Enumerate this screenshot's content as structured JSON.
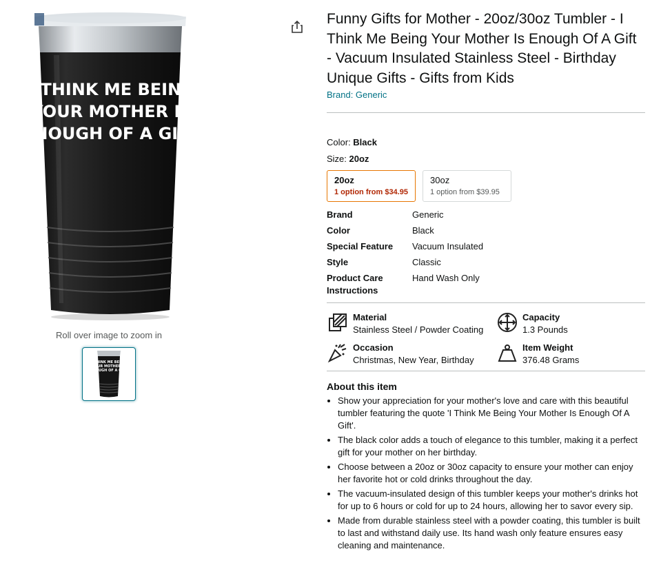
{
  "product": {
    "title": "Funny Gifts for Mother - 20oz/30oz Tumbler - I Think Me Being Your Mother Is Enough Of A Gift - Vacuum Insulated Stainless Steel - Birthday Unique Gifts - Gifts from Kids",
    "brand_link": "Brand: Generic",
    "image_text": [
      "I THINK ME BEING",
      "YOUR MOTHER IS",
      "ENOUGH OF A GIFT"
    ],
    "zoom_hint": "Roll over image to zoom in"
  },
  "variations": {
    "color_label": "Color: ",
    "color_value": "Black",
    "size_label": "Size: ",
    "size_value": "20oz",
    "options": [
      {
        "label": "20oz",
        "price": "1 option from $34.95",
        "selected": true
      },
      {
        "label": "30oz",
        "price": "1 option from $39.95",
        "selected": false
      }
    ]
  },
  "specs": [
    {
      "key": "Brand",
      "value": "Generic"
    },
    {
      "key": "Color",
      "value": "Black"
    },
    {
      "key": "Special Feature",
      "value": "Vacuum Insulated"
    },
    {
      "key": "Style",
      "value": "Classic"
    },
    {
      "key": "Product Care Instructions",
      "value": "Hand Wash Only"
    }
  ],
  "features": [
    {
      "icon": "material-icon",
      "title": "Material",
      "value": "Stainless Steel / Powder Coating"
    },
    {
      "icon": "capacity-icon",
      "title": "Capacity",
      "value": "1.3 Pounds"
    },
    {
      "icon": "occasion-icon",
      "title": "Occasion",
      "value": "Christmas, New Year, Birthday"
    },
    {
      "icon": "weight-icon",
      "title": "Item Weight",
      "value": "376.48 Grams"
    }
  ],
  "about": {
    "title": "About this item",
    "bullets": [
      "Show your appreciation for your mother's love and care with this beautiful tumbler featuring the quote 'I Think Me Being Your Mother Is Enough Of A Gift'.",
      "The black color adds a touch of elegance to this tumbler, making it a perfect gift for your mother on her birthday.",
      "Choose between a 20oz or 30oz capacity to ensure your mother can enjoy her favorite hot or cold drinks throughout the day.",
      "The vacuum-insulated design of this tumbler keeps your mother's drinks hot for up to 6 hours or cold for up to 24 hours, allowing her to savor every sip.",
      "Made from durable stainless steel with a powder coating, this tumbler is built to last and withstand daily use. Its hand wash only feature ensures easy cleaning and maintenance."
    ]
  },
  "colors": {
    "link": "#007185",
    "selected_border": "#e77600",
    "price_red": "#b12704",
    "divider": "#bbbfbf"
  }
}
